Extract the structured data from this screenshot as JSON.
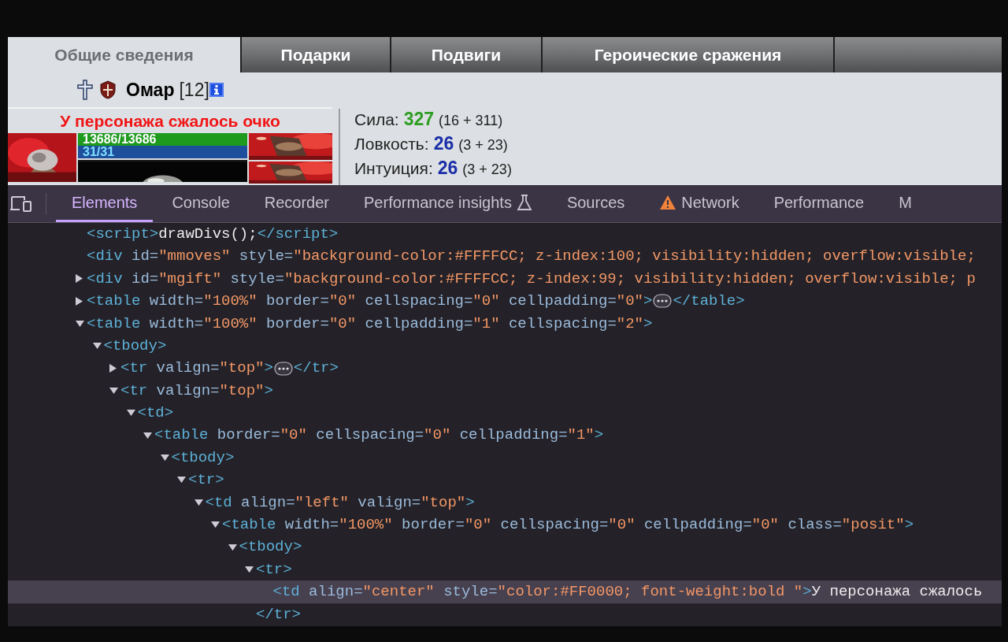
{
  "game": {
    "tabs": [
      {
        "label": "Общие сведения",
        "selected": true
      },
      {
        "label": "Подарки",
        "selected": false
      },
      {
        "label": "Подвиги",
        "selected": false
      },
      {
        "label": "Героические сражения",
        "selected": false
      }
    ],
    "character": {
      "name": "Омар",
      "level": "[12]"
    },
    "panel": {
      "title": "У персонажа сжалось очко",
      "hp": {
        "reading": "13686/13686",
        "level": 1
      },
      "mana": {
        "reading": "31/31",
        "level": 1
      }
    },
    "stats": [
      {
        "label": "Сила:",
        "value": "327",
        "color": "#2e9e22",
        "detail": "(16 + 311)"
      },
      {
        "label": "Ловкость:",
        "value": "26",
        "color": "#1a2fa8",
        "detail": "(3 + 23)"
      },
      {
        "label": "Интуиция:",
        "value": "26",
        "color": "#1a2fa8",
        "detail": "(3 + 23)"
      }
    ]
  },
  "devtools": {
    "tabs": [
      {
        "label": "Elements",
        "selected": true,
        "kind": "plain"
      },
      {
        "label": "Console",
        "selected": false,
        "kind": "plain"
      },
      {
        "label": "Recorder",
        "selected": false,
        "kind": "plain"
      },
      {
        "label": "Performance insights",
        "selected": false,
        "kind": "experimental"
      },
      {
        "label": "Sources",
        "selected": false,
        "kind": "plain"
      },
      {
        "label": "Network",
        "selected": false,
        "kind": "warning"
      },
      {
        "label": "Performance",
        "selected": false,
        "kind": "plain"
      },
      {
        "label": "M",
        "selected": false,
        "kind": "plain"
      }
    ],
    "dom": [
      {
        "selected": false,
        "tokens": [
          {
            "kind": "tag",
            "text": "<script>"
          },
          {
            "kind": "text",
            "text": "drawDivs();"
          },
          {
            "kind": "tag",
            "text": "</script>"
          }
        ]
      },
      {
        "selected": false,
        "tokens": [
          {
            "kind": "tag",
            "text": "<div"
          },
          {
            "kind": "attr",
            "text": " id="
          },
          {
            "kind": "value",
            "text": "\"mmoves\""
          },
          {
            "kind": "attr",
            "text": " style="
          },
          {
            "kind": "value",
            "text": "\"background-color:#FFFFCC; z-index:100; visibility:hidden; overflow:visible;"
          }
        ]
      },
      {
        "selected": false,
        "expanded": false,
        "tokens": [
          {
            "kind": "tag",
            "text": "<div"
          },
          {
            "kind": "attr",
            "text": " id="
          },
          {
            "kind": "value",
            "text": "\"mgift\""
          },
          {
            "kind": "attr",
            "text": " style="
          },
          {
            "kind": "value",
            "text": "\"background-color:#FFFFCC; z-index:99; visibility:hidden; overflow:visible; p"
          }
        ]
      },
      {
        "selected": false,
        "expanded": false,
        "tokens": [
          {
            "kind": "tag",
            "text": "<table"
          },
          {
            "kind": "attr",
            "text": " width="
          },
          {
            "kind": "value",
            "text": "\"100%\""
          },
          {
            "kind": "attr",
            "text": " border="
          },
          {
            "kind": "value",
            "text": "\"0\""
          },
          {
            "kind": "attr",
            "text": " cellspacing="
          },
          {
            "kind": "value",
            "text": "\"0\""
          },
          {
            "kind": "attr",
            "text": " cellpadding="
          },
          {
            "kind": "value",
            "text": "\"0\""
          },
          {
            "kind": "tag",
            "text": ">"
          },
          {
            "kind": "ellipsis"
          },
          {
            "kind": "tag",
            "text": "</table>"
          }
        ]
      },
      {
        "selected": false,
        "expanded": true,
        "tokens": [
          {
            "kind": "tag",
            "text": "<table"
          },
          {
            "kind": "attr",
            "text": " width="
          },
          {
            "kind": "value",
            "text": "\"100%\""
          },
          {
            "kind": "attr",
            "text": " border="
          },
          {
            "kind": "value",
            "text": "\"0\""
          },
          {
            "kind": "attr",
            "text": " cellpadding="
          },
          {
            "kind": "value",
            "text": "\"1\""
          },
          {
            "kind": "attr",
            "text": " cellspacing="
          },
          {
            "kind": "value",
            "text": "\"2\""
          },
          {
            "kind": "tag",
            "text": ">"
          }
        ],
        "children": [
          {
            "selected": false,
            "expanded": true,
            "tokens": [
              {
                "kind": "tag",
                "text": "<tbody>"
              }
            ],
            "children": [
              {
                "selected": false,
                "expanded": false,
                "tokens": [
                  {
                    "kind": "tag",
                    "text": "<tr"
                  },
                  {
                    "kind": "attr",
                    "text": " valign="
                  },
                  {
                    "kind": "value",
                    "text": "\"top\""
                  },
                  {
                    "kind": "tag",
                    "text": ">"
                  },
                  {
                    "kind": "ellipsis"
                  },
                  {
                    "kind": "tag",
                    "text": "</tr>"
                  }
                ]
              },
              {
                "selected": false,
                "expanded": true,
                "tokens": [
                  {
                    "kind": "tag",
                    "text": "<tr"
                  },
                  {
                    "kind": "attr",
                    "text": " valign="
                  },
                  {
                    "kind": "value",
                    "text": "\"top\""
                  },
                  {
                    "kind": "tag",
                    "text": ">"
                  }
                ],
                "children": [
                  {
                    "selected": false,
                    "expanded": true,
                    "tokens": [
                      {
                        "kind": "tag",
                        "text": "<td>"
                      }
                    ],
                    "children": [
                      {
                        "selected": false,
                        "expanded": true,
                        "tokens": [
                          {
                            "kind": "tag",
                            "text": "<table"
                          },
                          {
                            "kind": "attr",
                            "text": " border="
                          },
                          {
                            "kind": "value",
                            "text": "\"0\""
                          },
                          {
                            "kind": "attr",
                            "text": " cellspacing="
                          },
                          {
                            "kind": "value",
                            "text": "\"0\""
                          },
                          {
                            "kind": "attr",
                            "text": " cellpadding="
                          },
                          {
                            "kind": "value",
                            "text": "\"1\""
                          },
                          {
                            "kind": "tag",
                            "text": ">"
                          }
                        ],
                        "children": [
                          {
                            "selected": false,
                            "expanded": true,
                            "tokens": [
                              {
                                "kind": "tag",
                                "text": "<tbody>"
                              }
                            ],
                            "children": [
                              {
                                "selected": false,
                                "expanded": true,
                                "tokens": [
                                  {
                                    "kind": "tag",
                                    "text": "<tr>"
                                  }
                                ],
                                "children": [
                                  {
                                    "selected": false,
                                    "expanded": true,
                                    "tokens": [
                                      {
                                        "kind": "tag",
                                        "text": "<td"
                                      },
                                      {
                                        "kind": "attr",
                                        "text": " align="
                                      },
                                      {
                                        "kind": "value",
                                        "text": "\"left\""
                                      },
                                      {
                                        "kind": "attr",
                                        "text": " valign="
                                      },
                                      {
                                        "kind": "value",
                                        "text": "\"top\""
                                      },
                                      {
                                        "kind": "tag",
                                        "text": ">"
                                      }
                                    ],
                                    "children": [
                                      {
                                        "selected": false,
                                        "expanded": true,
                                        "tokens": [
                                          {
                                            "kind": "tag",
                                            "text": "<table"
                                          },
                                          {
                                            "kind": "attr",
                                            "text": " width="
                                          },
                                          {
                                            "kind": "value",
                                            "text": "\"100%\""
                                          },
                                          {
                                            "kind": "attr",
                                            "text": " border="
                                          },
                                          {
                                            "kind": "value",
                                            "text": "\"0\""
                                          },
                                          {
                                            "kind": "attr",
                                            "text": " cellspacing="
                                          },
                                          {
                                            "kind": "value",
                                            "text": "\"0\""
                                          },
                                          {
                                            "kind": "attr",
                                            "text": " cellpadding="
                                          },
                                          {
                                            "kind": "value",
                                            "text": "\"0\""
                                          },
                                          {
                                            "kind": "attr",
                                            "text": " class="
                                          },
                                          {
                                            "kind": "value",
                                            "text": "\"posit\""
                                          },
                                          {
                                            "kind": "tag",
                                            "text": ">"
                                          }
                                        ],
                                        "children": [
                                          {
                                            "selected": false,
                                            "expanded": true,
                                            "tokens": [
                                              {
                                                "kind": "tag",
                                                "text": "<tbody>"
                                              }
                                            ],
                                            "children": [
                                              {
                                                "selected": false,
                                                "expanded": true,
                                                "tokens": [
                                                  {
                                                    "kind": "tag",
                                                    "text": "<tr>"
                                                  }
                                                ],
                                                "closing": [
                                                  {
                                                    "kind": "tag",
                                                    "text": "</tr>"
                                                  }
                                                ],
                                                "children": [
                                                  {
                                                    "selected": true,
                                                    "tokens": [
                                                      {
                                                        "kind": "tag",
                                                        "text": "<td"
                                                      },
                                                      {
                                                        "kind": "attr",
                                                        "text": " align="
                                                      },
                                                      {
                                                        "kind": "value",
                                                        "text": "\"center\""
                                                      },
                                                      {
                                                        "kind": "attr",
                                                        "text": " style="
                                                      },
                                                      {
                                                        "kind": "value",
                                                        "text": "\"color:#FF0000; font-weight:bold \""
                                                      },
                                                      {
                                                        "kind": "tag",
                                                        "text": ">"
                                                      },
                                                      {
                                                        "kind": "text",
                                                        "text": "У персонажа сжалось"
                                                      }
                                                    ]
                                                  }
                                                ]
                                              }
                                            ]
                                          }
                                        ]
                                      }
                                    ]
                                  }
                                ]
                              }
                            ]
                          }
                        ]
                      }
                    ]
                  }
                ]
              }
            ]
          }
        ]
      }
    ]
  }
}
